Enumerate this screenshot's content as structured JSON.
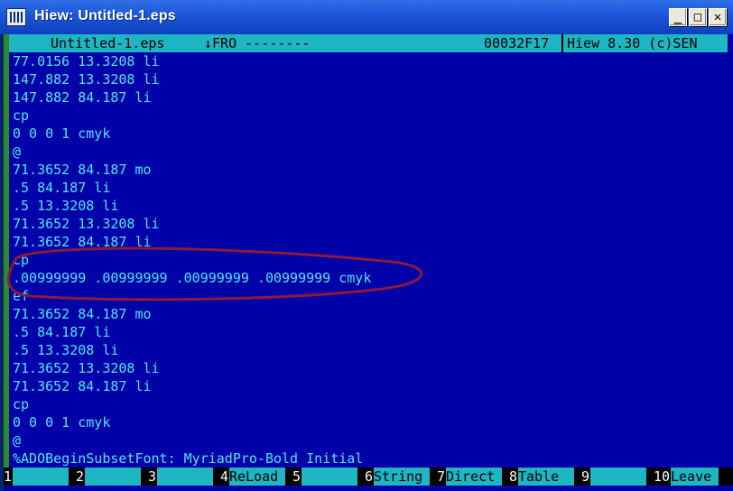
{
  "window": {
    "title": "Hiew: Untitled-1.eps",
    "min_glyph": "_",
    "max_glyph": "□",
    "close_glyph": "✕"
  },
  "status": {
    "filename": "Untitled-1.eps",
    "mode": "↓FRO --------",
    "offset": "00032F17",
    "version": "Hiew 8.30 (c)SEN"
  },
  "lines": [
    "77.0156 13.3208 li",
    "147.882 13.3208 li",
    "147.882 84.187 li",
    "cp",
    "0 0 0 1 cmyk",
    "@",
    "71.3652 84.187 mo",
    ".5 84.187 li",
    ".5 13.3208 li",
    "71.3652 13.3208 li",
    "71.3652 84.187 li",
    "cp",
    ".00999999 .00999999 .00999999 .00999999 cmyk",
    "ef",
    "71.3652 84.187 mo",
    ".5 84.187 li",
    ".5 13.3208 li",
    "71.3652 13.3208 li",
    "71.3652 84.187 li",
    "cp",
    "0 0 0 1 cmyk",
    "@",
    "%ADOBeginSubsetFont: MyriadPro-Bold Initial"
  ],
  "fkeys": [
    {
      "num": "1",
      "label": ""
    },
    {
      "num": "2",
      "label": ""
    },
    {
      "num": "3",
      "label": ""
    },
    {
      "num": "4",
      "label": "ReLoad"
    },
    {
      "num": "5",
      "label": ""
    },
    {
      "num": "6",
      "label": "String"
    },
    {
      "num": "7",
      "label": "Direct"
    },
    {
      "num": "8",
      "label": "Table"
    },
    {
      "num": "9",
      "label": ""
    },
    {
      "num": "10",
      "label": "Leave"
    }
  ],
  "colors": {
    "console_bg": "#0000a8",
    "text": "#4fe6ef",
    "status_bg": "#1db6c2",
    "annotation": "#8b1a3a"
  }
}
